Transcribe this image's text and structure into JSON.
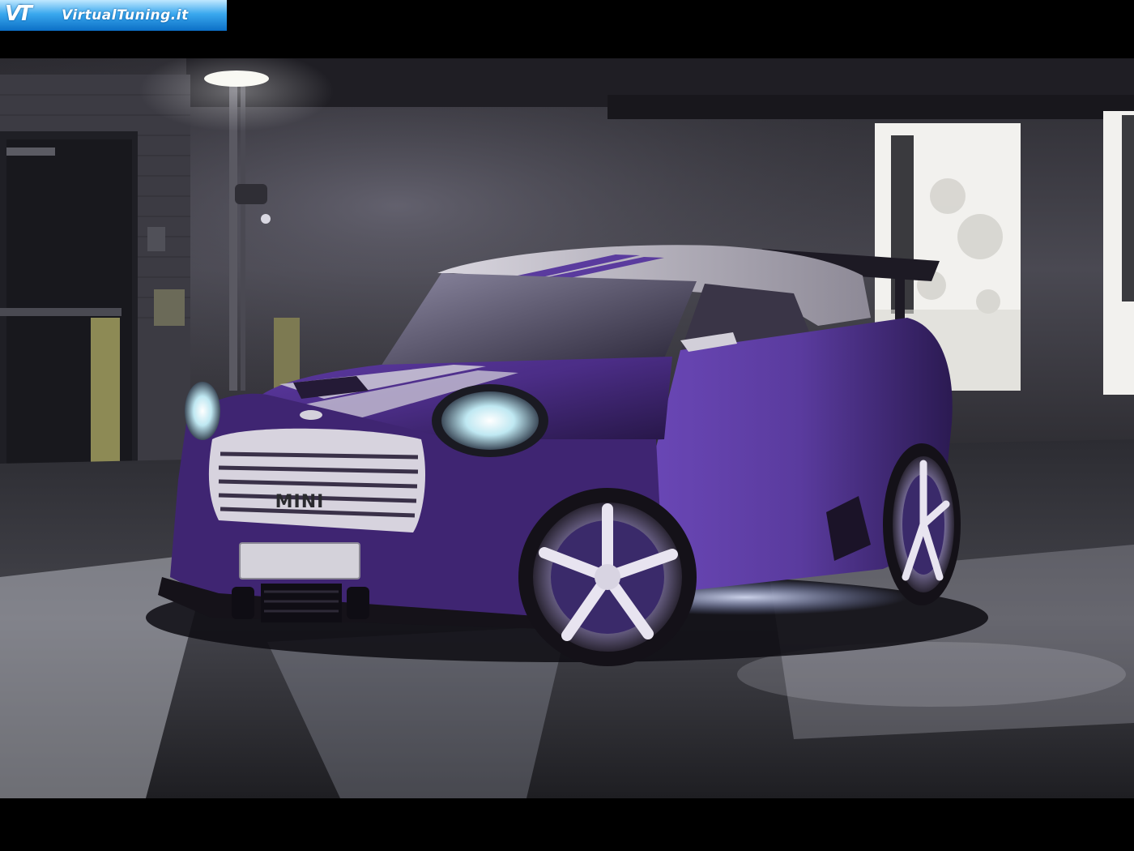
{
  "watermark": {
    "logo_letters": "VT",
    "site_name": "VirtualTuning.it"
  },
  "car": {
    "license_plate": "MINI"
  },
  "colors": {
    "car_body": "#4b2d86",
    "roof": "#c9c6cf",
    "floor": "#3a3a40",
    "wall": "#4a4952",
    "window_light": "#f2f1ee",
    "underglow": "#c9d7ff"
  }
}
